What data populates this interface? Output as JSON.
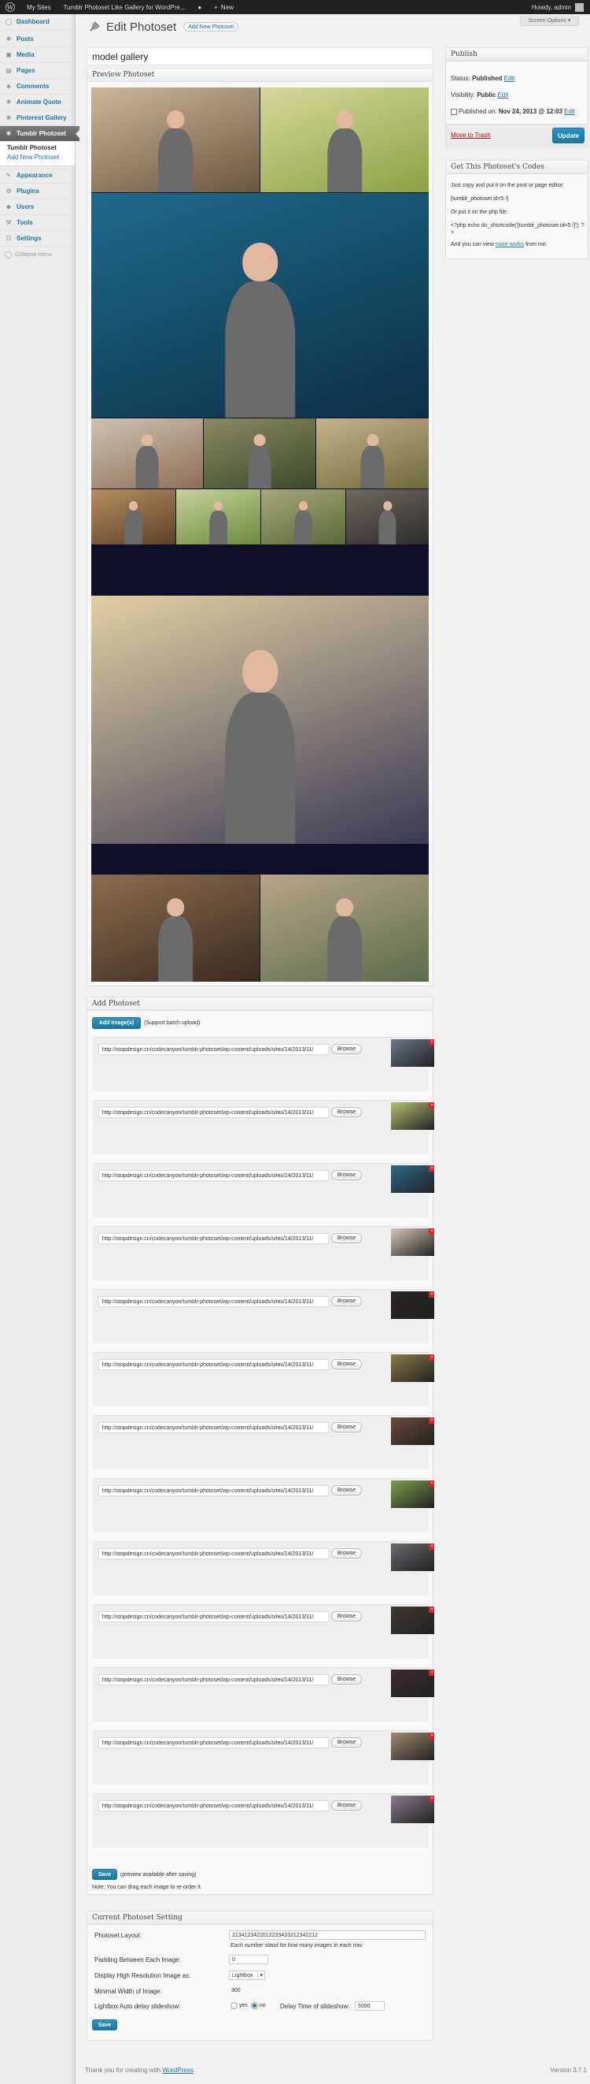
{
  "admin_bar": {
    "my_sites": "My Sites",
    "site_name": "Tumblr Photoset Like Gallery for WordPre...",
    "comments_count": "",
    "new_label": "New",
    "howdy": "Howdy, admin"
  },
  "sidebar": {
    "items": [
      {
        "label": "Dashboard",
        "icon": "dashboard-icon"
      },
      {
        "label": "Posts",
        "icon": "pin-icon"
      },
      {
        "label": "Media",
        "icon": "media-icon"
      },
      {
        "label": "Pages",
        "icon": "page-icon"
      },
      {
        "label": "Comments",
        "icon": "comment-icon"
      },
      {
        "label": "Animate Quote",
        "icon": "pin-icon"
      },
      {
        "label": "Pinterest Gallery",
        "icon": "pin-icon"
      },
      {
        "label": "Tumblr Photoset",
        "icon": "pin-icon"
      }
    ],
    "submenu": [
      "Tumblr Photoset",
      "Add New Photoset"
    ],
    "items2": [
      {
        "label": "Appearance",
        "icon": "appearance-icon"
      },
      {
        "label": "Plugins",
        "icon": "plugin-icon"
      },
      {
        "label": "Users",
        "icon": "users-icon"
      },
      {
        "label": "Tools",
        "icon": "tools-icon"
      },
      {
        "label": "Settings",
        "icon": "settings-icon"
      }
    ],
    "collapse": "Collapse menu"
  },
  "screen_options": "Screen Options",
  "page": {
    "title": "Edit Photoset",
    "add_new": "Add New Photoset",
    "post_title": "model gallery"
  },
  "preview": {
    "heading": "Preview Photoset"
  },
  "add_photoset": {
    "heading": "Add Photoset",
    "add_button": "Add Image(s)",
    "batch_note": "(Support batch upload)",
    "browse_label": "Browse",
    "image_url": "http://stopdesign.cn/codecanyon/tumblr-photoset/wp-content/uploads/sites/14/2013/11/",
    "save_button": "Save",
    "save_note": "(preview available after saving)",
    "drag_note": "Note: You can drag each image to re-order it."
  },
  "current_setting": {
    "heading": "Current Photoset Setting",
    "layout_label": "Photoset Layout:",
    "layout_value": "2134123422012233433212342212",
    "layout_help": "Each number stand for how many images in each row.",
    "padding_label": "Padding Between Each Image:",
    "padding_value": "0",
    "hires_label": "Display High Resolution Image as:",
    "hires_value": "Lightbox",
    "minwidth_label": "Minimal Width of Image:",
    "minwidth_value": "300",
    "autodelay_label": "Lightbox Auto delay slideshow:",
    "yes_label": "yes",
    "no_label": "no",
    "delaytime_label": "Delay Time of slideshow:",
    "delaytime_value": "5000",
    "save_button": "Save"
  },
  "publish": {
    "heading": "Publish",
    "status_label": "Status:",
    "status_value": "Published",
    "visibility_label": "Visibility:",
    "visibility_value": "Public",
    "edit": "Edit",
    "published_label": "Published on:",
    "published_value": "Nov 24, 2013 @ 12:03",
    "trash": "Move to Trash",
    "update": "Update"
  },
  "codes": {
    "heading": "Get This Photoset's Codes",
    "line1": "Just copy and put it on the post or page editor:",
    "shortcode": "[tumblr_photoset id=5 /]",
    "line2": "Or put it on the php file:",
    "phpcode": "<?php echo do_shortcode('[tumblr_photoset id=5 /]'); ?>",
    "line3_pre": "And you can view ",
    "line3_link": "more works",
    "line3_post": " from me."
  },
  "footer": {
    "thanks": "Thank you for creating with ",
    "wordpress": "WordPress",
    "version": "Version 3.7.1"
  },
  "colors": {
    "link": "#21759b",
    "admin_bar": "#222222",
    "primary_button": "#21759b",
    "trash": "#bc0b0b",
    "preview_bg": "#0f1028"
  }
}
